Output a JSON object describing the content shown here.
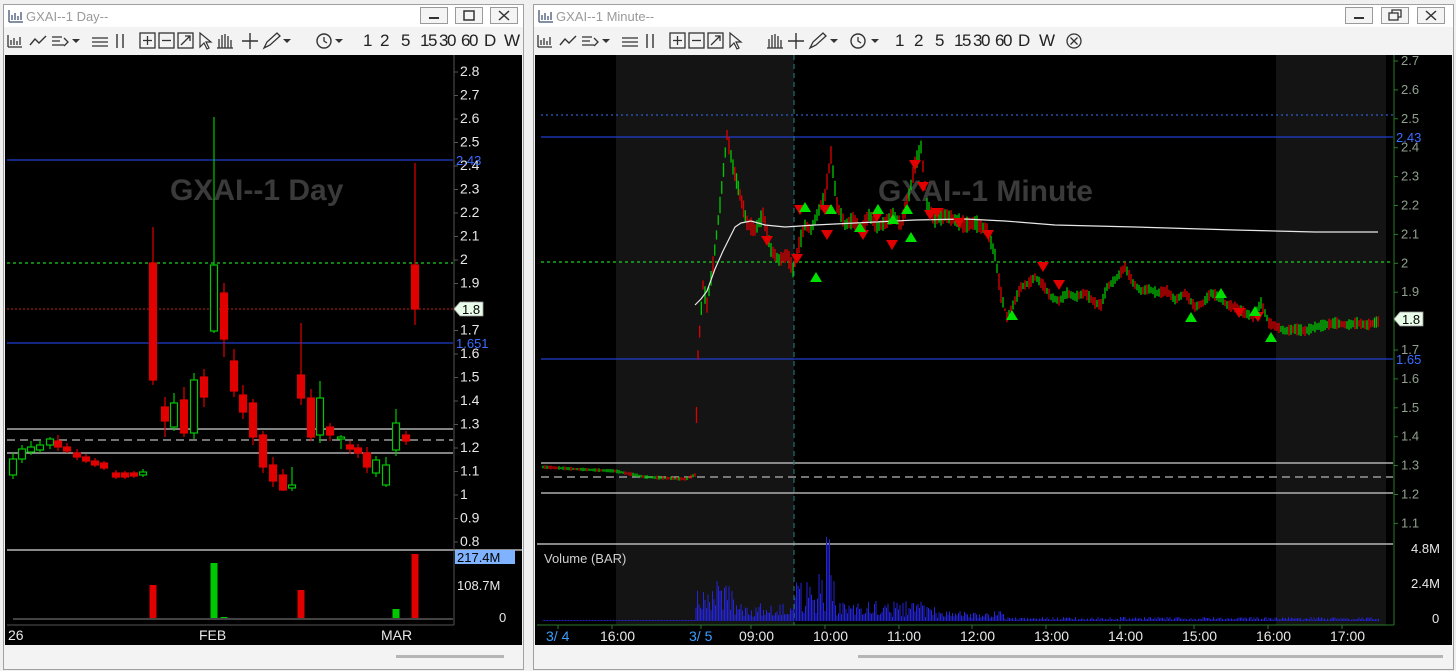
{
  "left_window": {
    "title": "GXAI--1 Day--",
    "watermark": "GXAI--1 Day",
    "toolbar": {
      "periods": [
        "1",
        "2",
        "5",
        "15",
        "30",
        "60",
        "D",
        "W"
      ]
    },
    "price_axis": {
      "ticks": [
        "2.8",
        "2.7",
        "2.6",
        "2.5",
        "2.4",
        "2.3",
        "2.2",
        "2.1",
        "2",
        "1.9",
        "1.8",
        "1.7",
        "1.6",
        "1.5",
        "1.4",
        "1.3",
        "1.2",
        "1.1",
        "1",
        "0.9",
        "0.8"
      ]
    },
    "line_labels": {
      "upper": "2.43",
      "lower": "1.651"
    },
    "current_price": "1.8",
    "volume_axis": {
      "top": "217.4M",
      "mid": "108.7M",
      "bottom": "0"
    },
    "time_axis": {
      "labels": [
        "26",
        "FEB",
        "MAR"
      ]
    }
  },
  "right_window": {
    "title": "GXAI--1 Minute--",
    "watermark": "GXAI--1 Minute",
    "toolbar": {
      "periods": [
        "1",
        "2",
        "5",
        "15",
        "30",
        "60",
        "D",
        "W"
      ]
    },
    "price_axis": {
      "ticks": [
        "2.7",
        "2.6",
        "2.5",
        "2.4",
        "2.3",
        "2.2",
        "2.1",
        "2",
        "1.9",
        "1.8",
        "1.7",
        "1.6",
        "1.5",
        "1.4",
        "1.3",
        "1.2",
        "1.1"
      ]
    },
    "line_labels": {
      "upper": "2.43",
      "lower": "1.65"
    },
    "current_price": "1.8",
    "volume_title": "Volume (BAR)",
    "volume_axis": {
      "top": "4.8M",
      "mid": "2.4M",
      "bottom": "0"
    },
    "time_axis": {
      "labels": [
        "3/ 4",
        "16:00",
        "3/ 5",
        "09:00",
        "10:00",
        "11:00",
        "12:00",
        "13:00",
        "14:00",
        "15:00",
        "16:00",
        "17:00"
      ]
    }
  },
  "colors": {
    "up": "#00c800",
    "down": "#e00000",
    "level_line": "#1f3fd0",
    "dotted_green": "#22cc22",
    "label_blue": "#3a6cff"
  }
}
